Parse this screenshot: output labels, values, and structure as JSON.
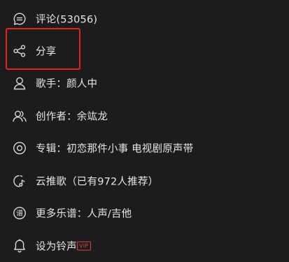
{
  "menu": {
    "items": [
      {
        "key": "comments",
        "icon": "comment-icon",
        "label": "评论(53056)"
      },
      {
        "key": "share",
        "icon": "share-icon",
        "label": "分享"
      },
      {
        "key": "singer",
        "icon": "person-icon",
        "label": "歌手：颜人中"
      },
      {
        "key": "creator",
        "icon": "people-icon",
        "label": "创作者：余竑龙"
      },
      {
        "key": "album",
        "icon": "album-icon",
        "label": "专辑：初恋那件小事 电视剧原声带"
      },
      {
        "key": "cloud-recommend",
        "icon": "cloud-music-icon",
        "label": "云推歌（已有972人推荐）"
      },
      {
        "key": "sheet-music",
        "icon": "sheet-music-icon",
        "label": "更多乐谱：人声/吉他"
      },
      {
        "key": "ringtone",
        "icon": "bell-icon",
        "label": "设为铃声",
        "badge": "VIP"
      }
    ]
  },
  "highlight": {
    "target": "share",
    "color": "#e1251b"
  },
  "colors": {
    "background": "#1c1c1e",
    "text": "#e6e6e6",
    "icon": "#d8d8d8",
    "vip": "#e0443a"
  }
}
